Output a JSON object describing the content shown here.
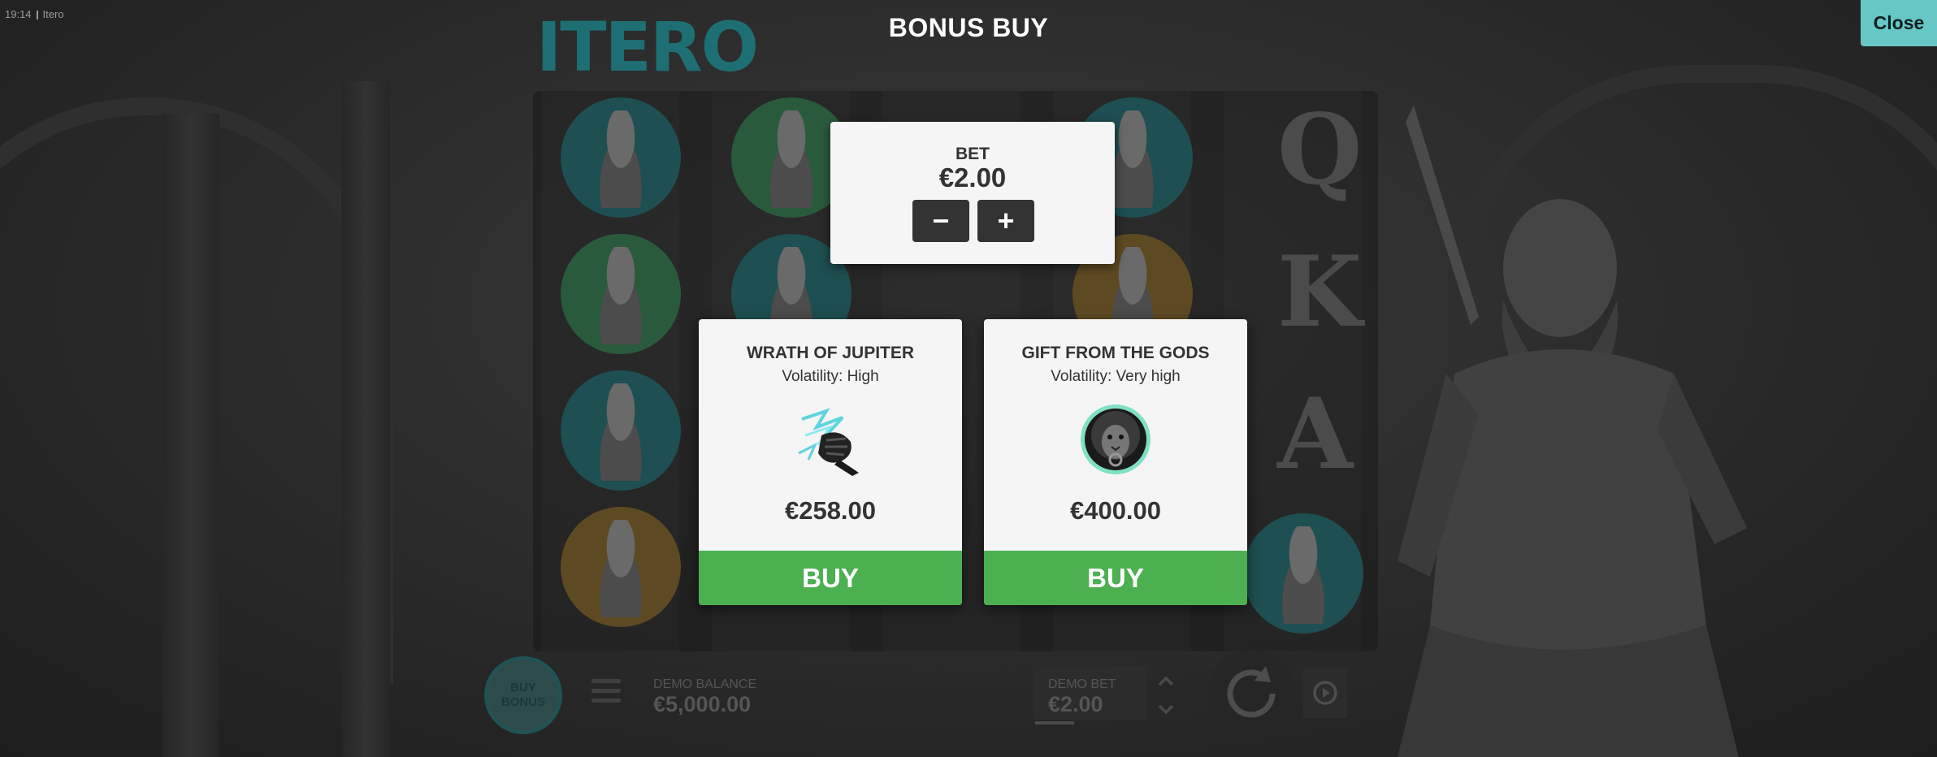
{
  "status_bar": {
    "time": "19:14",
    "app_name": "Itero"
  },
  "game": {
    "logo_text": "ITERO",
    "reel_letters": [
      "Q",
      "K",
      "A"
    ],
    "bottom_bar": {
      "buy_bonus_line1": "BUY",
      "buy_bonus_line2": "BONUS",
      "balance_label": "DEMO BALANCE",
      "balance_value": "€5,000.00",
      "bet_label": "DEMO BET",
      "bet_value": "€2.00"
    }
  },
  "modal": {
    "title": "BONUS BUY",
    "close_label": "Close",
    "bet": {
      "label": "BET",
      "value": "€2.00",
      "decrease_label": "−",
      "increase_label": "+"
    },
    "features": [
      {
        "title": "WRATH OF JUPITER",
        "volatility": "Volatility: High",
        "price": "€258.00",
        "buy_label": "BUY",
        "icon": "lightning-fist-icon"
      },
      {
        "title": "GIFT FROM THE GODS",
        "volatility": "Volatility: Very high",
        "price": "€400.00",
        "buy_label": "BUY",
        "icon": "lion-medallion-icon"
      }
    ]
  },
  "colors": {
    "accent": "#67c7c5",
    "buy_green": "#4caf50",
    "logo_teal": "#1e6f73",
    "overlay_dim": "#2b2b2b"
  }
}
